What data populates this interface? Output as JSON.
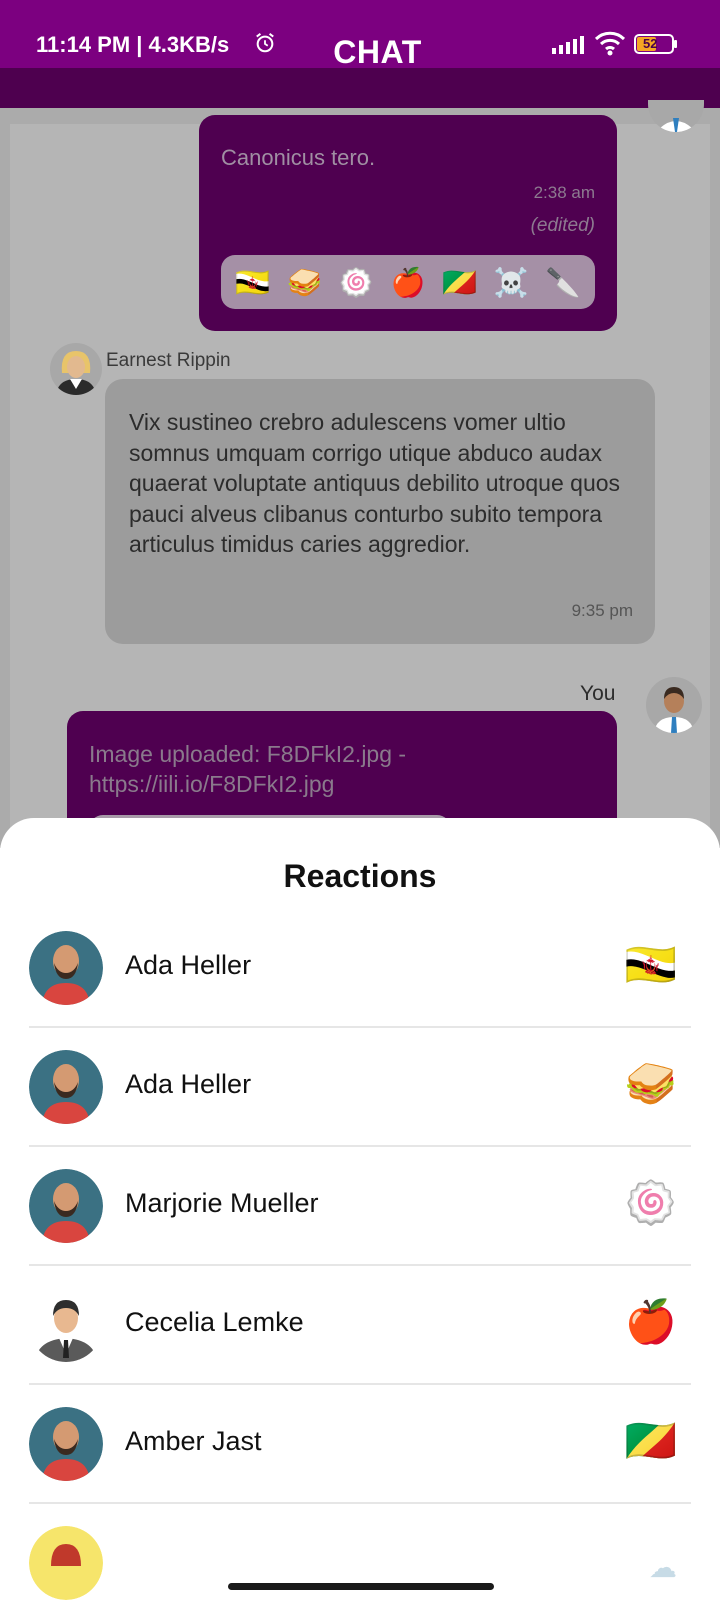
{
  "status_bar": {
    "time": "11:14 PM | 4.3KB/s",
    "battery": "52",
    "icons": [
      "alarm-icon",
      "signal-icon",
      "wifi-icon",
      "battery-icon"
    ]
  },
  "header": {
    "title": "CHAT"
  },
  "messages": [
    {
      "text": "Canonicus tero.",
      "time": "2:38 am",
      "edited": "(edited)",
      "reactions": [
        "🇧🇳",
        "🥪",
        "🍥",
        "🍎",
        "🇨🇬",
        "☠️",
        "🔪"
      ]
    },
    {
      "sender": "Earnest Rippin",
      "text": "Vix sustineo crebro adulescens vomer ultio somnus umquam corrigo utique abduco audax quaerat voluptate antiquus debilito utroque quos pauci alveus clibanus conturbo subito tempora articulus timidus caries aggredior.",
      "time": "9:35 pm"
    },
    {
      "sender": "You",
      "text": "Image uploaded: F8DFkI2.jpg - https://iili.io/F8DFkI2.jpg"
    }
  ],
  "reactions_sheet": {
    "title": "Reactions",
    "items": [
      {
        "name": "Ada Heller",
        "emoji": "🇧🇳",
        "avatar": "bearded-man-avatar"
      },
      {
        "name": "Ada Heller",
        "emoji": "🥪",
        "avatar": "bearded-man-avatar"
      },
      {
        "name": "Marjorie Mueller",
        "emoji": "🍥",
        "avatar": "bearded-man-avatar"
      },
      {
        "name": "Cecelia Lemke",
        "emoji": "🍎",
        "avatar": "businessman-avatar"
      },
      {
        "name": "Amber Jast",
        "emoji": "🇨🇬",
        "avatar": "bearded-man-avatar"
      }
    ]
  },
  "colors": {
    "status_bar": "#7c0080",
    "subheader": "#4e004f",
    "own_bubble": "#4f0050",
    "avatar_bg": "#3b7183",
    "shirt": "#d9453f"
  }
}
